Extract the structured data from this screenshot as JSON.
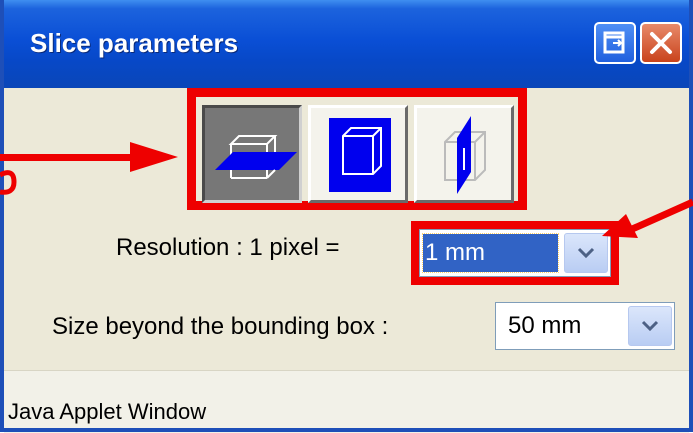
{
  "window": {
    "title": "Slice parameters",
    "restore_icon": "restore-icon",
    "close_icon": "close-icon"
  },
  "view_buttons": [
    {
      "name": "axial-view",
      "icon": "axial-plane-icon",
      "selected": true
    },
    {
      "name": "coronal-view",
      "icon": "coronal-plane-icon",
      "selected": false
    },
    {
      "name": "sagittal-view",
      "icon": "sagittal-plane-icon",
      "selected": false
    }
  ],
  "resolution": {
    "label": "Resolution : 1 pixel =",
    "value": "1 mm"
  },
  "size": {
    "label": "Size beyond the bounding box :",
    "value": "50 mm"
  },
  "footer": {
    "text": "Java Applet Window"
  },
  "colors": {
    "titlebar": "#0a4fd6",
    "highlight": "#ee0000",
    "plane": "#0000ee",
    "selection": "#3163c5"
  }
}
